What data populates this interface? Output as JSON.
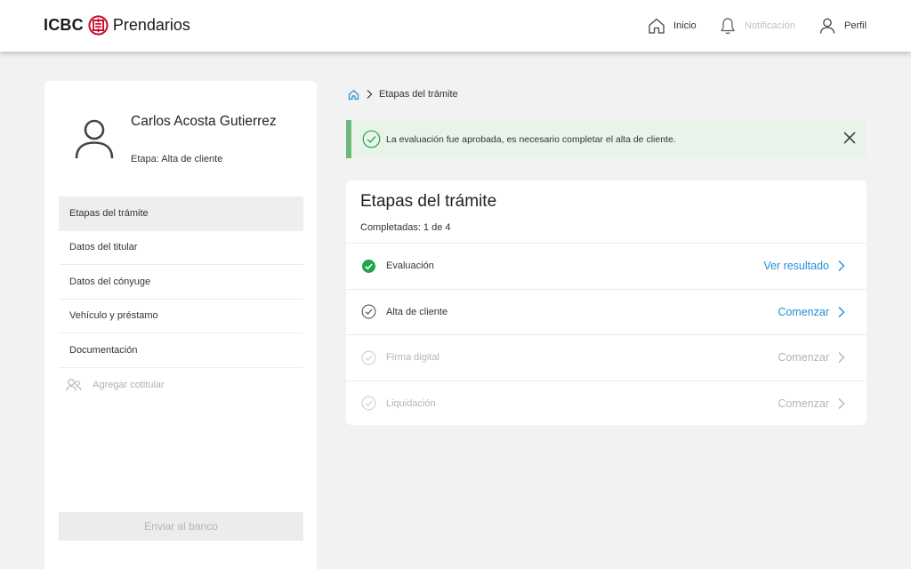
{
  "header": {
    "brand_mark": "ICBC",
    "brand_name": "Prendarios",
    "nav": [
      {
        "label": "Inicio",
        "icon": "home-icon",
        "enabled": true
      },
      {
        "label": "Notificación",
        "icon": "bell-icon",
        "enabled": false
      },
      {
        "label": "Perfil",
        "icon": "user-icon",
        "enabled": true
      }
    ]
  },
  "sidebar": {
    "user_name": "Carlos Acosta Gutierrez",
    "stage": "Etapa: Alta de cliente",
    "items": [
      {
        "label": "Etapas del trámite",
        "active": true
      },
      {
        "label": "Datos del titular"
      },
      {
        "label": "Datos del cónyuge"
      },
      {
        "label": "Vehículo y préstamo"
      },
      {
        "label": "Documentación"
      }
    ],
    "add_cotitular": "Agregar cotitular",
    "send_button": "Enviar al banco"
  },
  "breadcrumb": {
    "current": "Etapas del trámite"
  },
  "alert": {
    "message": "La evaluación fue aprobada, es necesario completar el alta de cliente."
  },
  "steps_card": {
    "title": "Etapas del trámite",
    "completed": "Completadas: 1 de 4",
    "steps": [
      {
        "name": "Evaluación",
        "action": "Ver resultado",
        "state": "done"
      },
      {
        "name": "Alta de cliente",
        "action": "Comenzar",
        "state": "pending"
      },
      {
        "name": "Firma digital",
        "action": "Comenzar",
        "state": "disabled"
      },
      {
        "name": "Liquidación",
        "action": "Comenzar",
        "state": "disabled"
      }
    ]
  },
  "colors": {
    "accent_link": "#1f8fd6",
    "success": "#1fa64a",
    "alert_border": "#6db87a",
    "alert_bg": "#eaf3ea",
    "brand_red": "#c8102e"
  }
}
